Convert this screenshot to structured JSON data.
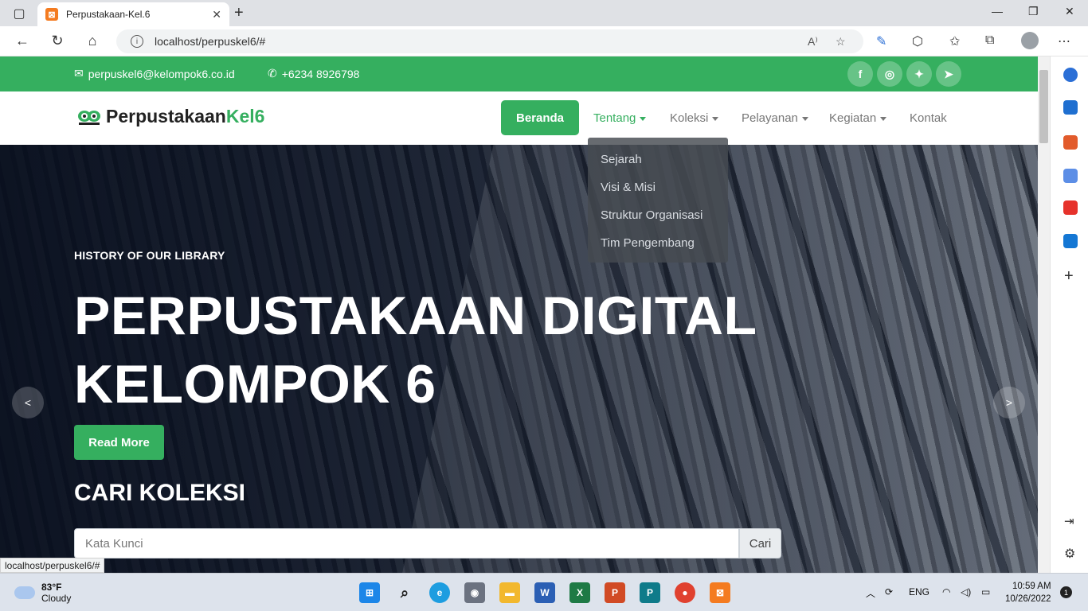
{
  "browser": {
    "tab_title": "Perpustakaan-Kel.6",
    "url": "localhost/perpuskel6/#",
    "status_url": "localhost/perpuskel6/#"
  },
  "topbar": {
    "email": "perpuskel6@kelompok6.co.id",
    "phone": "+6234 8926798",
    "social": [
      "f",
      "ig",
      "tw",
      "tg"
    ]
  },
  "navbar": {
    "brand_main": "Perpustakaan",
    "brand_accent": "Kel6",
    "home": "Beranda",
    "links": [
      "Tentang",
      "Koleksi",
      "Pelayanan",
      "Kegiatan",
      "Kontak"
    ],
    "dropdown": [
      "Sejarah",
      "Visi & Misi",
      "Struktur Organisasi",
      "Tim Pengembang"
    ]
  },
  "hero": {
    "kicker": "HISTORY OF OUR LIBRARY",
    "title_line1": "PERPUSTAKAAN DIGITAL",
    "title_line2": "KELOMPOK 6",
    "read_more": "Read More",
    "search_heading": "CARI KOLEKSI",
    "search_placeholder": "Kata Kunci",
    "search_button": "Cari",
    "prev": "<",
    "next": ">"
  },
  "taskbar": {
    "temp": "83°F",
    "weather": "Cloudy",
    "lang": "ENG",
    "time": "10:59 AM",
    "date": "10/26/2022",
    "notifications": "1"
  },
  "colors": {
    "accent": "#35af5f"
  }
}
